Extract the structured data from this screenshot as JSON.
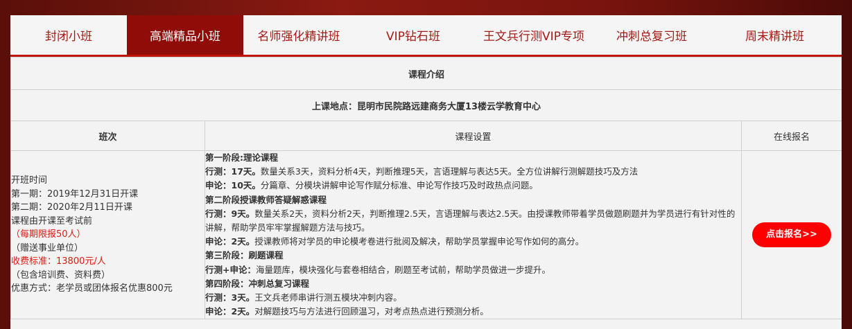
{
  "tabs": [
    {
      "label": "封闭小班"
    },
    {
      "label": "高端精品小班"
    },
    {
      "label": "名师强化精讲班"
    },
    {
      "label": "VIP钻石班"
    },
    {
      "label": "王文兵行测VIP专项"
    },
    {
      "label": "冲刺总复习班"
    },
    {
      "label": "周末精讲班"
    }
  ],
  "active_tab": "高端精品小班",
  "table": {
    "title": "课程介绍",
    "location": "上课地点：昆明市民院路远建商务大厦13楼云学教育中心",
    "headers": [
      "班次",
      "课程设置",
      "在线报名"
    ],
    "class_info": [
      "开班时间",
      "第一期：2019年12月31日开课",
      "第二期：2020年2月11日开课",
      "课程由开课至考试前",
      "（每期限报50人）",
      "（赠送事业单位）",
      "收费标准：13800元/人",
      "（包含培训费、资料费）",
      "优惠方式：老学员或团体报名优惠800元"
    ],
    "course_lines": [
      {
        "label": "第一阶段:理论课程",
        "text": ""
      },
      {
        "label": "行测：17天。",
        "text": "数量关系3天，资料分析4天，判断推理5天，言语理解与表达5天。全方位讲解行测解题技巧及方法"
      },
      {
        "label": "申论：10天。",
        "text": "分篇章、分模块讲解申论写作赋分标准、申论写作技巧及时政热点问题。"
      },
      {
        "label": "第二阶段授课教师答疑解惑课程",
        "text": ""
      },
      {
        "label": "行测：9天。",
        "text": "数量关系2天，资料分析2天，判断推理2.5天，言语理解与表达2.5天。由授课教师带着学员做题刷题并为学员进行有针对性的讲解，帮助学员牢牢掌握解题方法与技巧。"
      },
      {
        "label": "申论：2天。",
        "text": "授课教师将对学员的申论模考卷进行批阅及解决，帮助学员掌握申论写作如何的高分。"
      },
      {
        "label": "第三阶段：刷题课程",
        "text": ""
      },
      {
        "label": "行测+申论：",
        "text": "海量题库，模块强化与套卷相结合，刷题至考试前，帮助学员做进一步提升。"
      },
      {
        "label": "第四阶段：冲刺总复习课程",
        "text": ""
      },
      {
        "label": "行测：3天。",
        "text": "王文兵老师串讲行测五模块冲刺内容。"
      },
      {
        "label": "申论：2天。",
        "text": "对解题技巧与方法进行回顾温习，对考点热点进行预测分析。"
      }
    ],
    "signup_button": "点击报名>>"
  }
}
